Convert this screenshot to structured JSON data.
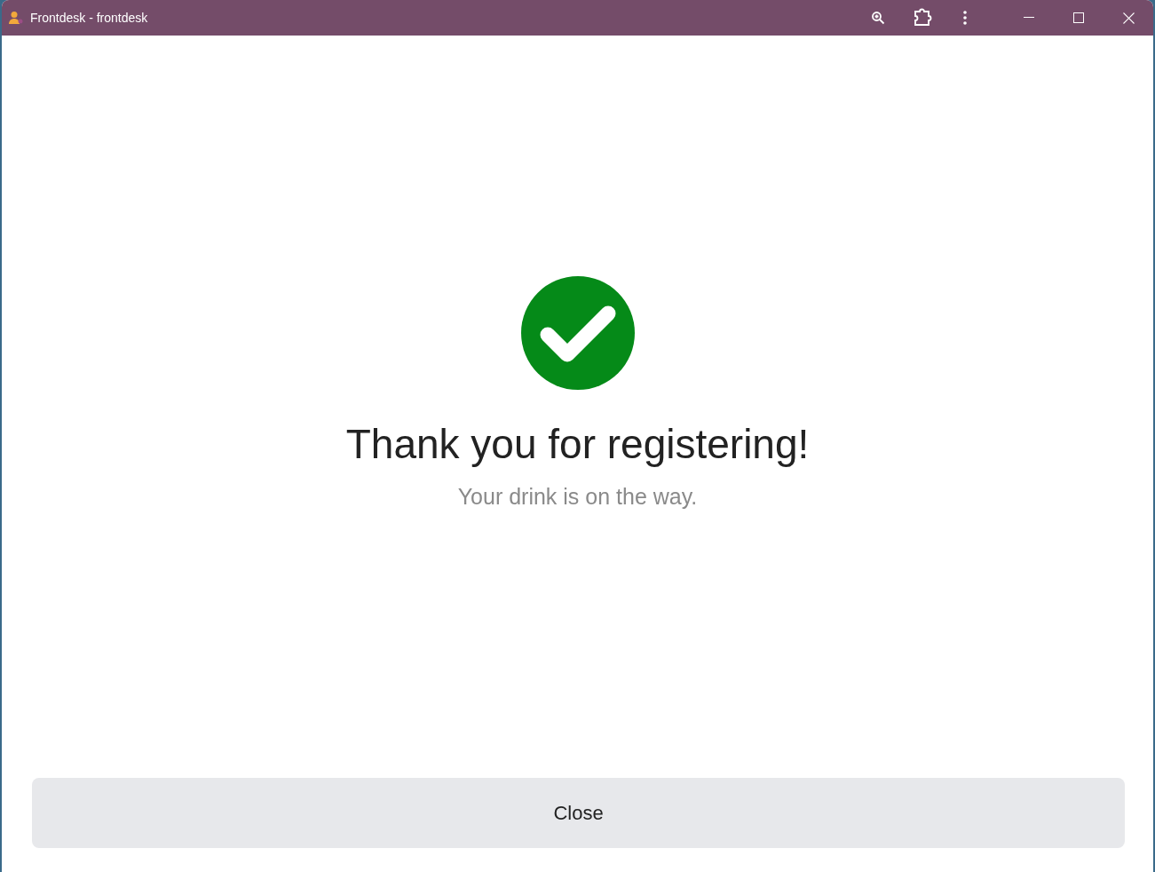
{
  "window": {
    "title": "Frontdesk - frontdesk"
  },
  "message": {
    "heading": "Thank you for registering!",
    "subtext": "Your drink is on the way."
  },
  "buttons": [
    "Close"
  ]
}
